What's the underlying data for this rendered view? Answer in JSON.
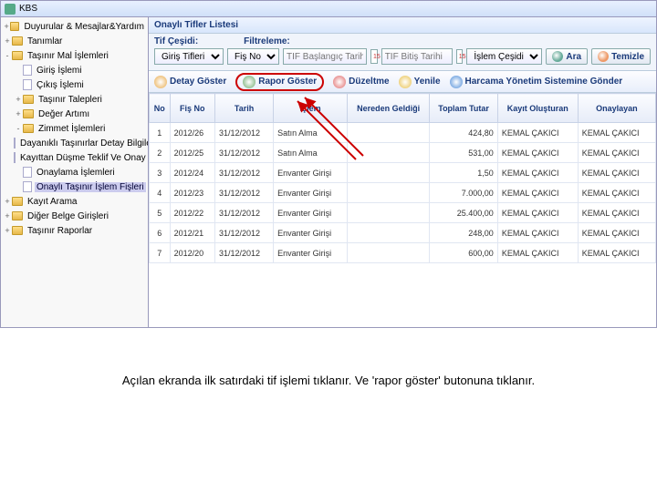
{
  "window_title": "KBS",
  "panel_title": "Onaylı Tifler Listesi",
  "tree": [
    {
      "t": "+",
      "f": 1,
      "d": 0,
      "lbl": "Duyurular & Mesajlar&Yardım"
    },
    {
      "t": "+",
      "f": 1,
      "d": 0,
      "lbl": "Tanımlar"
    },
    {
      "t": "-",
      "f": 1,
      "d": 0,
      "lbl": "Taşınır Mal İşlemleri"
    },
    {
      "t": "",
      "f": 0,
      "d": 1,
      "lbl": "Giriş İşlemi"
    },
    {
      "t": "",
      "f": 0,
      "d": 1,
      "lbl": "Çıkış İşlemi"
    },
    {
      "t": "+",
      "f": 1,
      "d": 1,
      "lbl": "Taşınır Talepleri"
    },
    {
      "t": "+",
      "f": 1,
      "d": 1,
      "lbl": "Değer Artımı"
    },
    {
      "t": "-",
      "f": 1,
      "d": 1,
      "lbl": "Zimmet İşlemleri"
    },
    {
      "t": "",
      "f": 0,
      "d": 1,
      "lbl": "Dayanıklı Taşınırlar Detay Bilgileri"
    },
    {
      "t": "",
      "f": 0,
      "d": 1,
      "lbl": "Kayıttan Düşme Teklif Ve Onay Tutanağı"
    },
    {
      "t": "",
      "f": 0,
      "d": 1,
      "lbl": "Onaylama İşlemleri"
    },
    {
      "t": "",
      "f": 0,
      "d": 1,
      "lbl": "Onaylı Taşınır İşlem Fişleri",
      "sel": 1
    },
    {
      "t": "+",
      "f": 1,
      "d": 0,
      "lbl": "Kayıt Arama"
    },
    {
      "t": "+",
      "f": 1,
      "d": 0,
      "lbl": "Diğer Belge Girişleri"
    },
    {
      "t": "+",
      "f": 1,
      "d": 0,
      "lbl": "Taşınır Raporlar"
    }
  ],
  "filters": {
    "label_tif": "Tif Çeşidi:",
    "label_filt": "Filtreleme:",
    "sel_tif": "Giriş Tifleri",
    "sel_fis": "Fiş No",
    "ph_start": "TIF Başlangıç Tarih",
    "ph_end": "TIF Bitiş Tarihi",
    "sel_islem": "İşlem Çeşidi",
    "btn_search": "Ara",
    "btn_clear": "Temizle"
  },
  "toolbar": {
    "detail": "Detay Göster",
    "report": "Rapor Göster",
    "fix": "Düzeltme",
    "refresh": "Yenile",
    "send": "Harcama Yönetim Sistemine Gönder"
  },
  "cols": [
    "No",
    "Fiş No",
    "Tarih",
    "İşlem",
    "Nereden Geldiği",
    "Toplam Tutar",
    "Kayıt Oluşturan",
    "Onaylayan"
  ],
  "rows": [
    {
      "no": 1,
      "fis": "2012/26",
      "tarih": "31/12/2012",
      "islem": "Satın Alma",
      "ner": "",
      "tut": "424,80",
      "kayit": "KEMAL ÇAKICI",
      "onay": "KEMAL ÇAKICI"
    },
    {
      "no": 2,
      "fis": "2012/25",
      "tarih": "31/12/2012",
      "islem": "Satın Alma",
      "ner": "",
      "tut": "531,00",
      "kayit": "KEMAL ÇAKICI",
      "onay": "KEMAL ÇAKICI"
    },
    {
      "no": 3,
      "fis": "2012/24",
      "tarih": "31/12/2012",
      "islem": "Envanter Girişi",
      "ner": "",
      "tut": "1,50",
      "kayit": "KEMAL ÇAKICI",
      "onay": "KEMAL ÇAKICI"
    },
    {
      "no": 4,
      "fis": "2012/23",
      "tarih": "31/12/2012",
      "islem": "Envanter Girişi",
      "ner": "",
      "tut": "7.000,00",
      "kayit": "KEMAL ÇAKICI",
      "onay": "KEMAL ÇAKICI"
    },
    {
      "no": 5,
      "fis": "2012/22",
      "tarih": "31/12/2012",
      "islem": "Envanter Girişi",
      "ner": "",
      "tut": "25.400,00",
      "kayit": "KEMAL ÇAKICI",
      "onay": "KEMAL ÇAKICI"
    },
    {
      "no": 6,
      "fis": "2012/21",
      "tarih": "31/12/2012",
      "islem": "Envanter Girişi",
      "ner": "",
      "tut": "248,00",
      "kayit": "KEMAL ÇAKICI",
      "onay": "KEMAL ÇAKICI"
    },
    {
      "no": 7,
      "fis": "2012/20",
      "tarih": "31/12/2012",
      "islem": "Envanter Girişi",
      "ner": "",
      "tut": "600,00",
      "kayit": "KEMAL ÇAKICI",
      "onay": "KEMAL ÇAKICI"
    }
  ],
  "caption": "Açılan ekranda ilk satırdaki tif işlemi tıklanır. Ve  'rapor göster' butonuna tıklanır."
}
